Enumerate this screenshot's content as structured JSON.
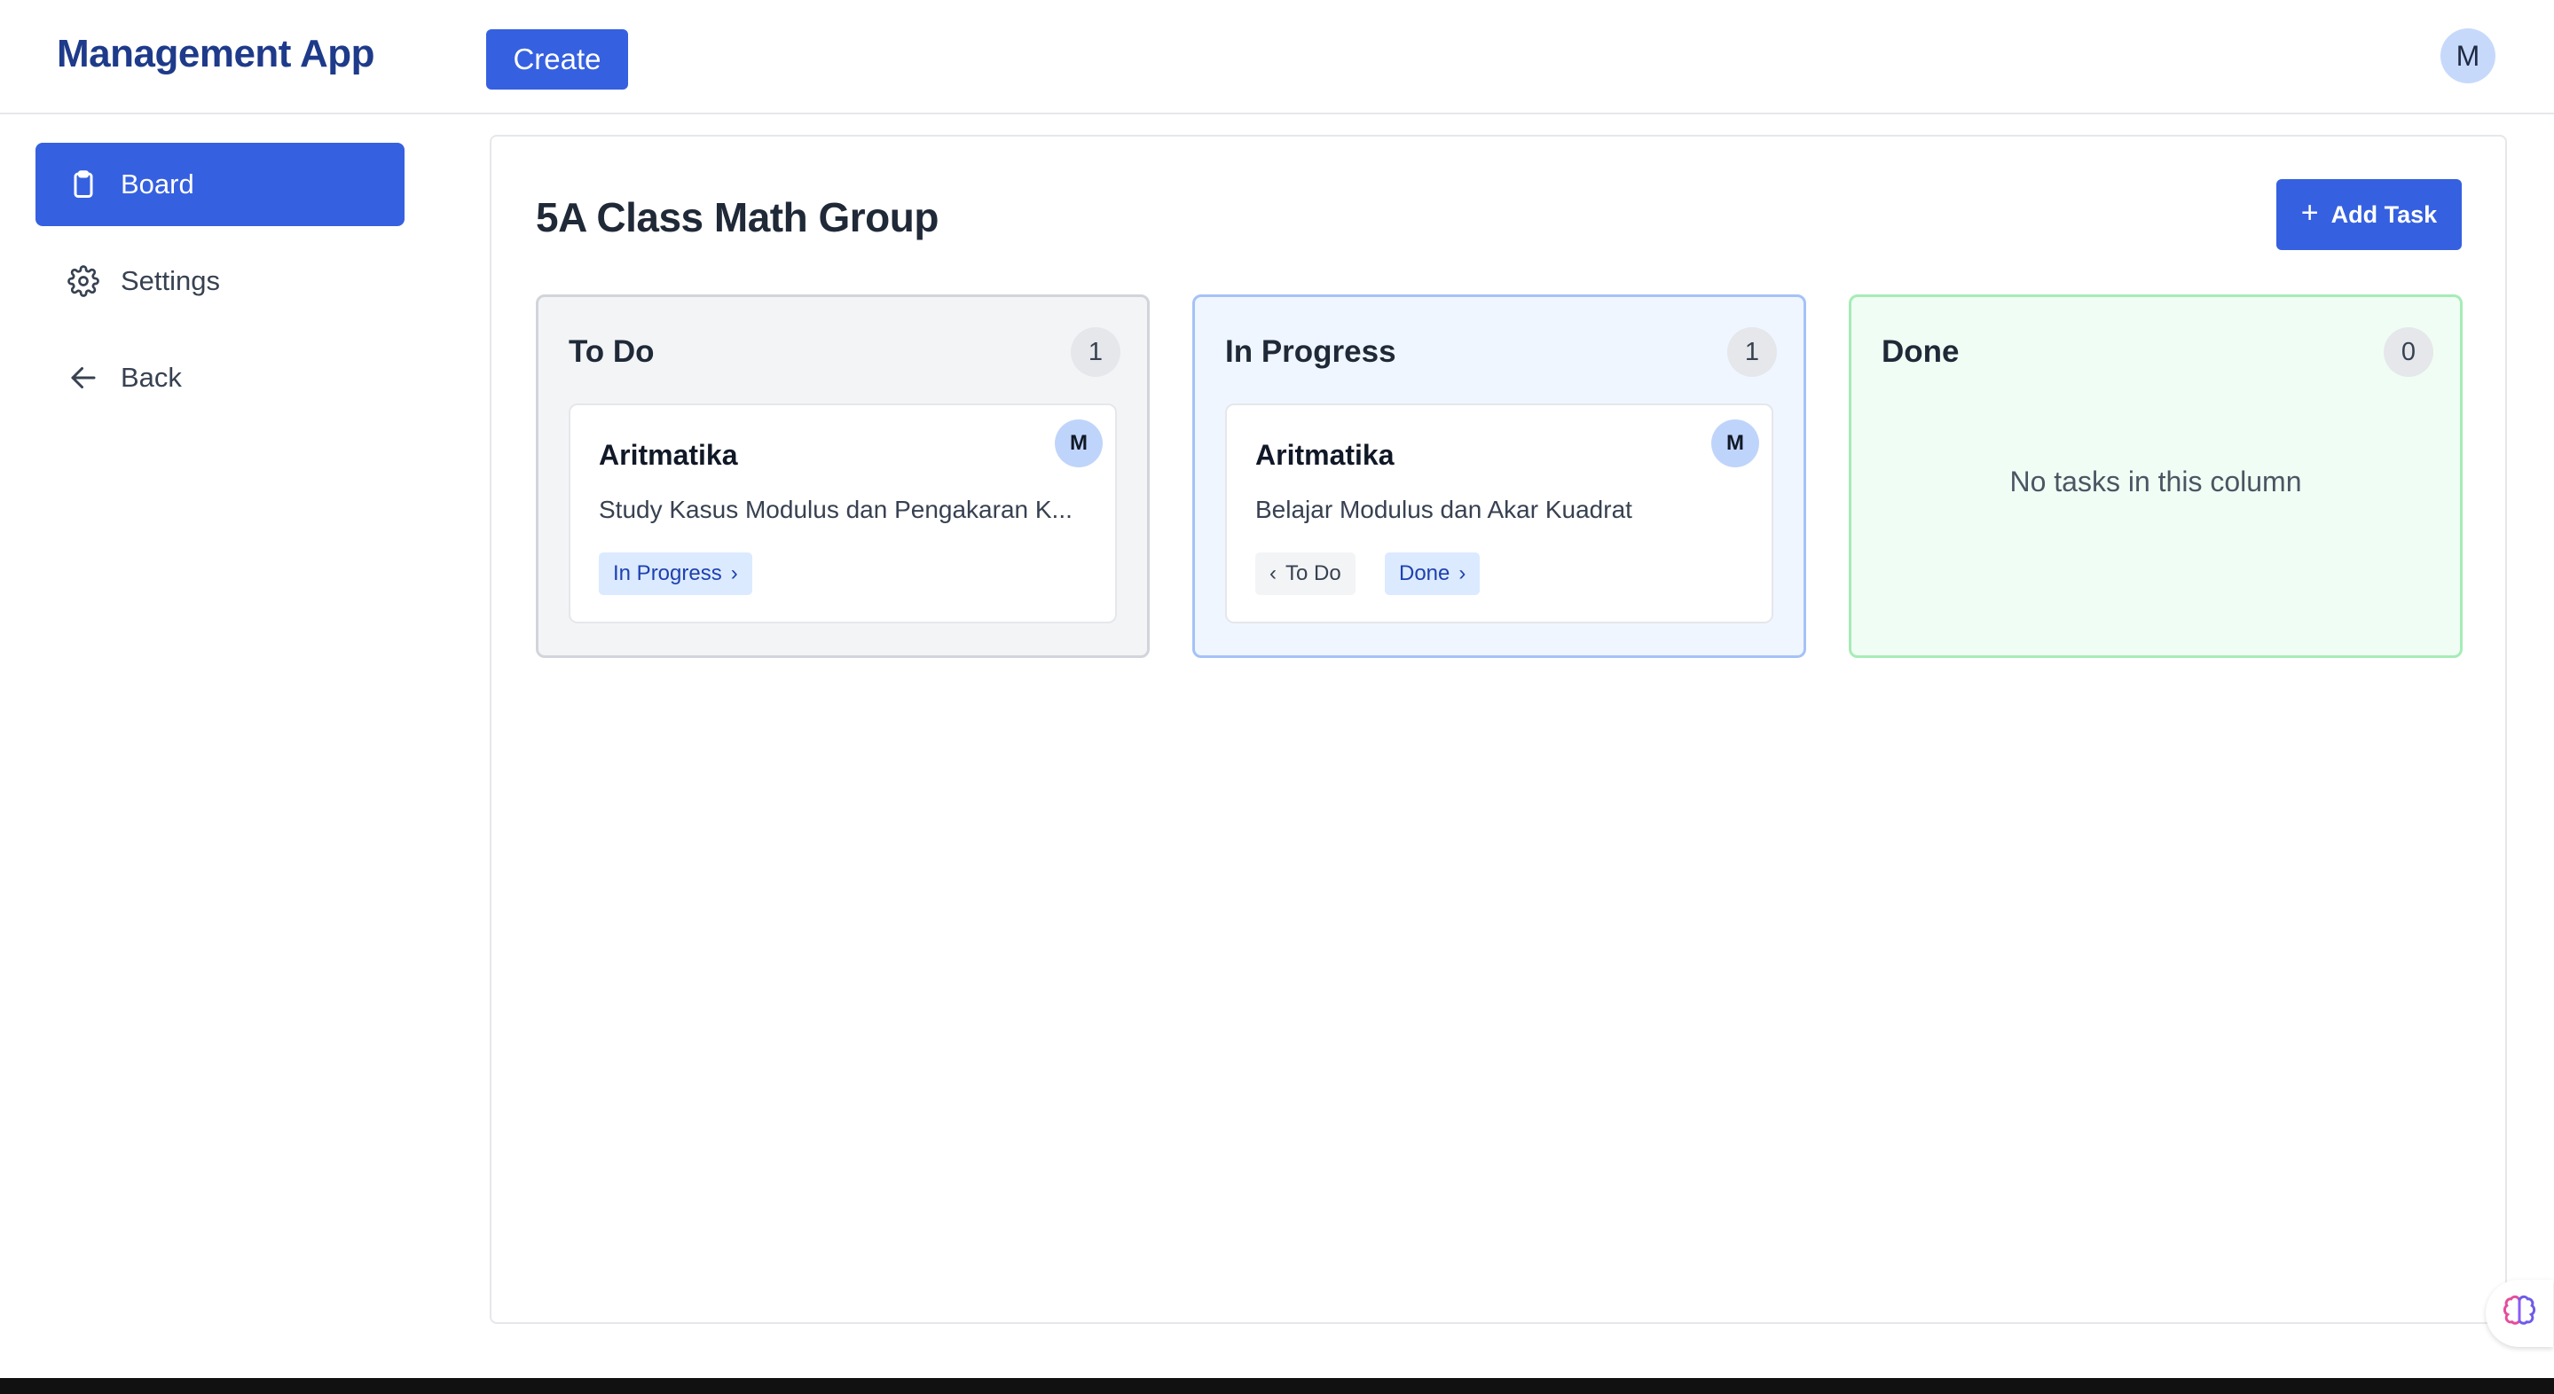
{
  "app": {
    "title": "Management App"
  },
  "header": {
    "create_label": "Create",
    "avatar_initial": "M"
  },
  "sidebar": {
    "items": [
      {
        "label": "Board",
        "icon": "clipboard-icon",
        "active": true
      },
      {
        "label": "Settings",
        "icon": "gear-icon",
        "active": false
      },
      {
        "label": "Back",
        "icon": "arrow-left-icon",
        "active": false
      }
    ]
  },
  "main": {
    "title": "5A Class Math Group",
    "add_task_label": "Add Task",
    "columns": [
      {
        "title": "To Do",
        "count": "1",
        "cards": [
          {
            "title": "Aritmatika",
            "description": "Study Kasus Modulus dan Pengakaran K...",
            "avatar": "M",
            "next_label": "In Progress"
          }
        ]
      },
      {
        "title": "In Progress",
        "count": "1",
        "cards": [
          {
            "title": "Aritmatika",
            "description": "Belajar Modulus dan Akar Kuadrat",
            "avatar": "M",
            "prev_label": "To Do",
            "next_label": "Done"
          }
        ]
      },
      {
        "title": "Done",
        "count": "0",
        "empty_message": "No tasks in this column",
        "cards": []
      }
    ]
  },
  "colors": {
    "primary": "#3560e0",
    "brand_text": "#1e3a8a",
    "todo_border": "#d1d5db",
    "progress_border": "#a5c2f7",
    "done_border": "#a6ecb7"
  }
}
